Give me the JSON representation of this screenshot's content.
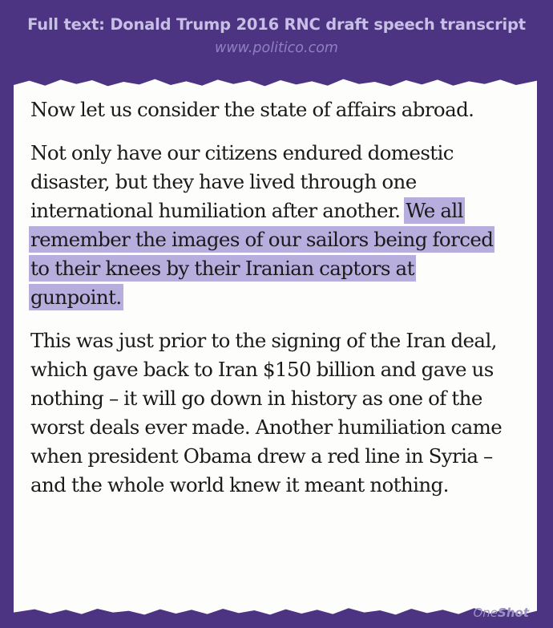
{
  "header": {
    "title": "Full text: Donald Trump 2016 RNC draft speech transcript",
    "source": "www.politico.com"
  },
  "document": {
    "paragraph_1": {
      "line_1": "Now let us consider the state of affairs abroad."
    },
    "paragraph_2": {
      "line_1": "Not only have our citizens endured domestic",
      "line_2": "disaster, but they have lived through one",
      "line_3_plain": "international humiliation after another. ",
      "line_3_highlight": "We all",
      "line_4_highlight": "remember the images of our sailors being forced",
      "line_5_highlight": "to their knees by their Iranian captors at",
      "line_6_highlight": "gunpoint."
    },
    "paragraph_3": {
      "line_1": "This was just prior to the signing of the Iran deal,",
      "line_2": "which gave back to Iran $150 billion and gave us",
      "line_3": "nothing – it will go down in history as one of the",
      "line_4": "worst deals ever made. Another humiliation came",
      "line_5": "when president Obama drew a red line in Syria –",
      "line_6": "and the whole world knew it meant nothing."
    },
    "highlight_color": "#b7aedd"
  },
  "branding": {
    "prefix": "One",
    "suffix": "Shot"
  },
  "colors": {
    "background": "#4c3483",
    "title": "#c7bfe6",
    "paper": "#fdfdfc"
  }
}
